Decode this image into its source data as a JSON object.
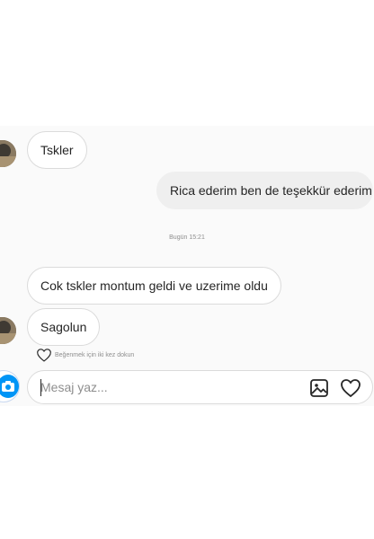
{
  "thread": {
    "messages": [
      {
        "direction": "incoming",
        "text": "Tskler"
      },
      {
        "direction": "outgoing",
        "text": "Rica ederim ben de teşekkür ederim"
      },
      {
        "direction": "incoming",
        "text": "Cok tskler montum geldi ve uzerime oldu"
      },
      {
        "direction": "incoming",
        "text": "Sagolun"
      }
    ],
    "timestamp": "Bugün 15:21",
    "like_hint": "Beğenmek için iki kez dokun"
  },
  "composer": {
    "placeholder": "Mesaj yaz...",
    "value": ""
  },
  "icons": {
    "camera": "camera-icon",
    "gallery": "image-icon",
    "like": "heart-icon",
    "like_hint": "heart-outline-icon"
  },
  "colors": {
    "accent": "#0095f6",
    "bubble_border": "#dbdbdb",
    "outgoing_bubble": "#efefef",
    "muted_text": "#8e8e8e"
  }
}
